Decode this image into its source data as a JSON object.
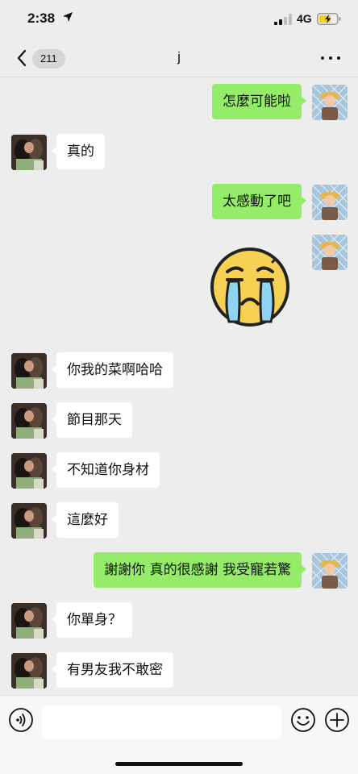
{
  "status_bar": {
    "time": "2:38",
    "network": "4G",
    "icons": [
      "location-arrow-icon",
      "signal-icon",
      "battery-charging-icon"
    ]
  },
  "nav": {
    "back_count": "211",
    "title": "j",
    "icons": [
      "chevron-left-icon",
      "more-icon"
    ]
  },
  "messages": [
    {
      "side": "out",
      "text": "怎麼可能啦"
    },
    {
      "side": "in",
      "text": "真的"
    },
    {
      "side": "out",
      "text": "太感動了吧"
    },
    {
      "side": "out",
      "type": "sticker",
      "icon": "crying-face-sticker"
    },
    {
      "side": "in",
      "text": "你我的菜啊哈哈"
    },
    {
      "side": "in",
      "text": "節目那天"
    },
    {
      "side": "in",
      "text": "不知道你身材"
    },
    {
      "side": "in",
      "text": "這麼好"
    },
    {
      "side": "out",
      "text": "謝謝你 真的很感謝 我受寵若驚"
    },
    {
      "side": "in",
      "text": "你單身？"
    },
    {
      "side": "in",
      "text": "有男友我不敢密"
    }
  ],
  "input_bar": {
    "value": "",
    "placeholder": "",
    "icons": [
      "voice-icon",
      "emoji-icon",
      "plus-icon"
    ]
  },
  "colors": {
    "background": "#ededed",
    "outgoing_bubble": "#95ec69",
    "incoming_bubble": "#ffffff",
    "battery": "#f2d21b"
  }
}
